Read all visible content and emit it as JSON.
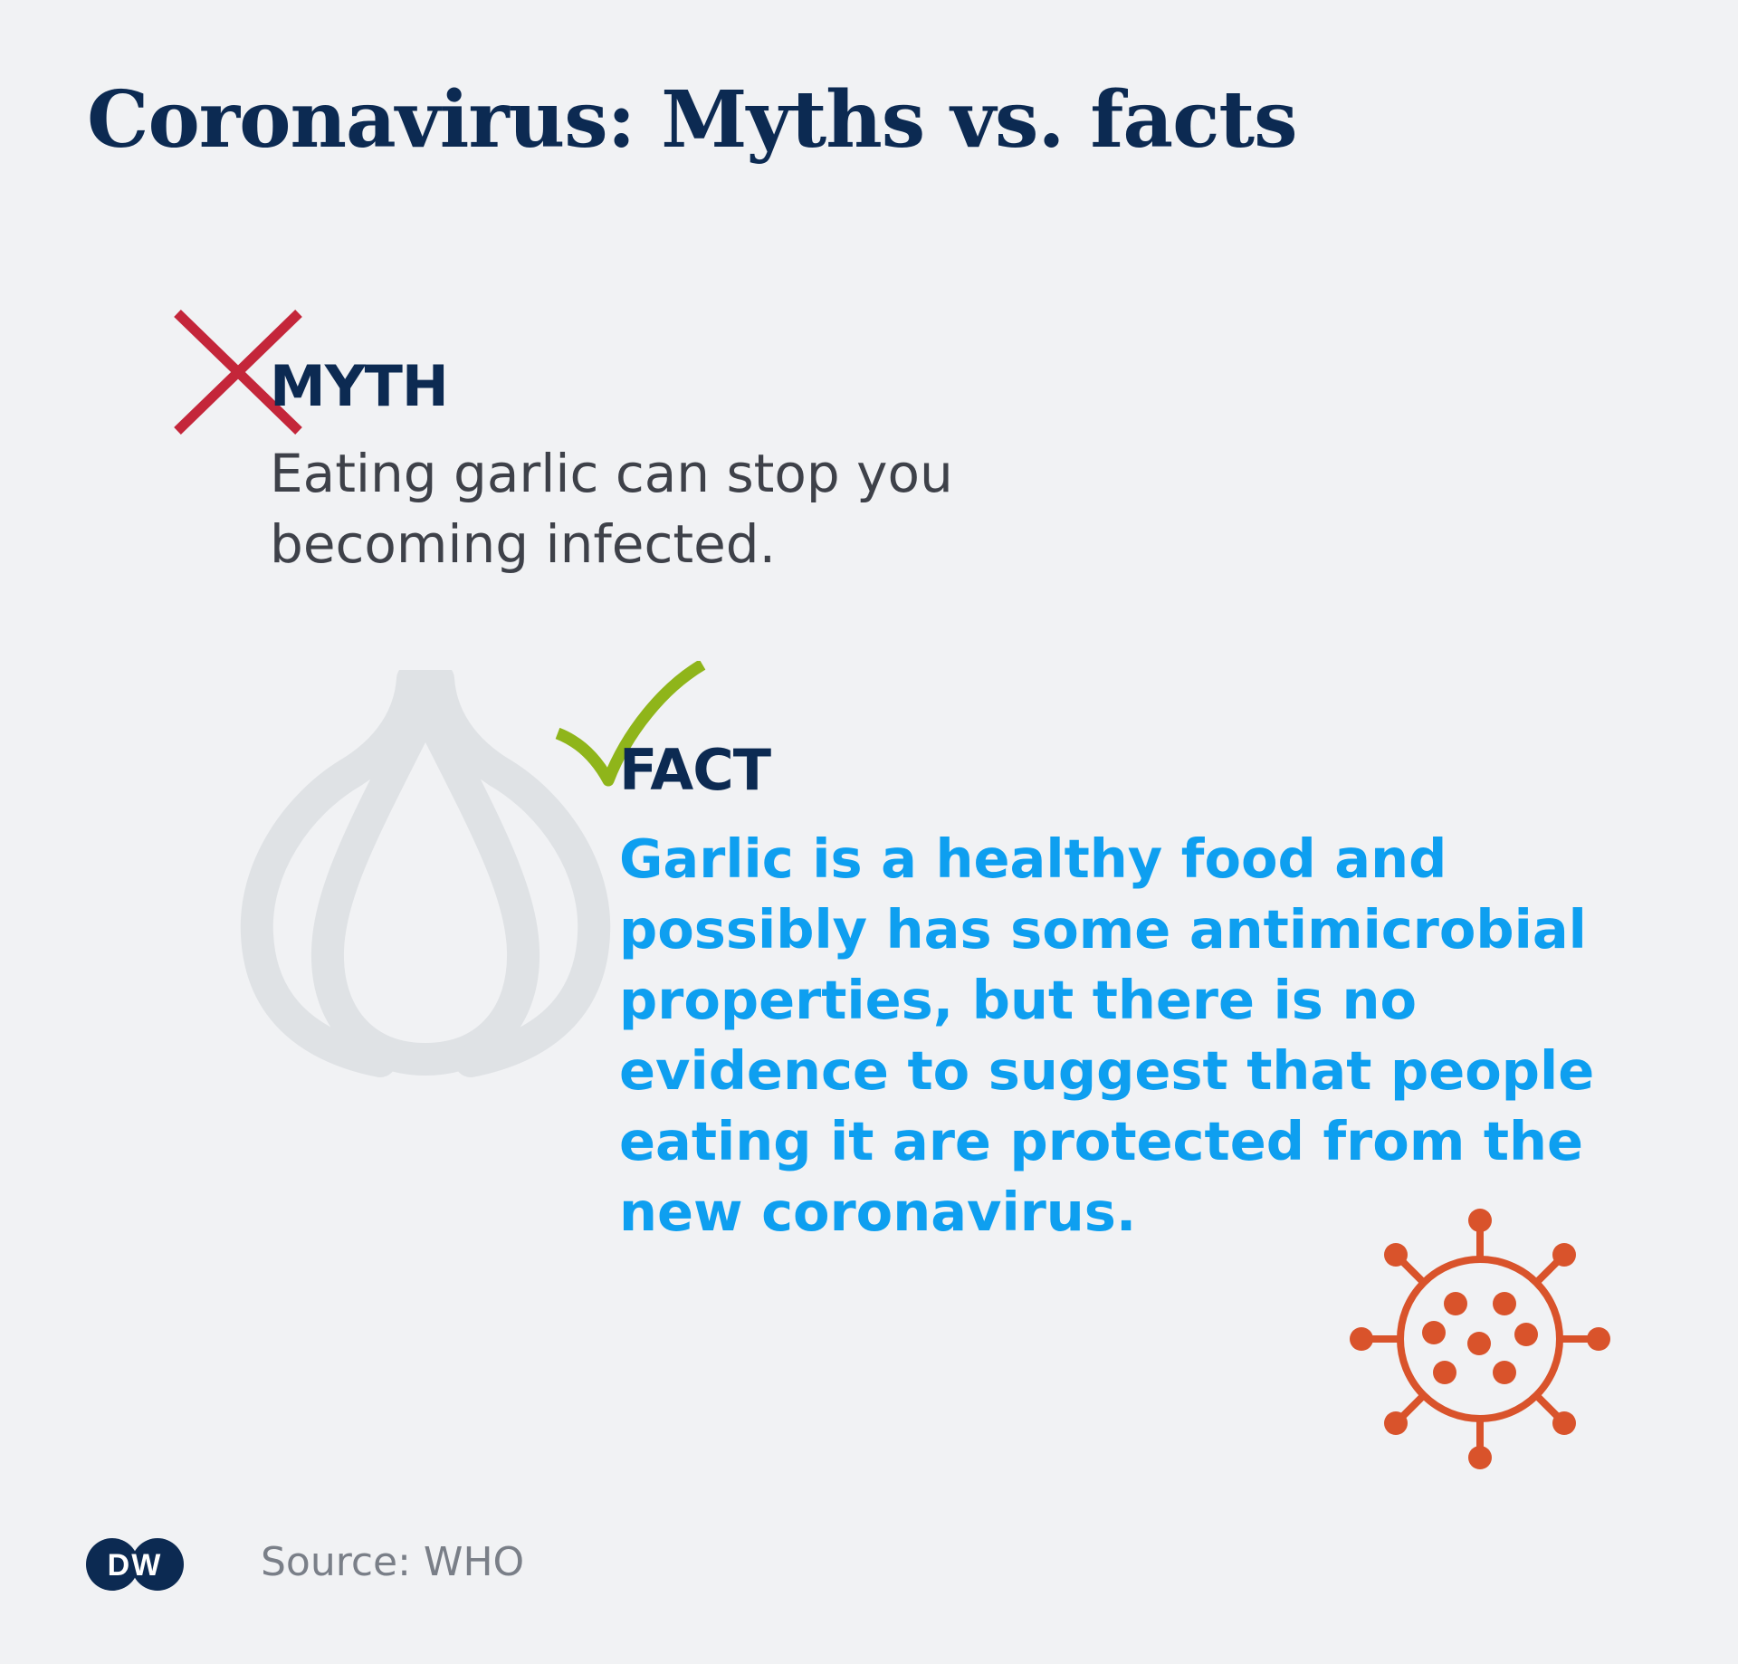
{
  "title": "Coronavirus: Myths vs. facts",
  "myth": {
    "label": "MYTH",
    "text": "Eating garlic can stop you becoming infected.",
    "icon": "cross-mark-icon",
    "color": "#c4263a"
  },
  "fact": {
    "label": "FACT",
    "text": "Garlic is a healthy food and possibly has some antimicrobial properties, but there is no evidence to suggest that people eating it are protected from the new coronavirus.",
    "icon": "check-mark-icon",
    "color": "#8fb51a",
    "text_color": "#0e9ff0"
  },
  "illustrations": {
    "garlic": "garlic-icon",
    "virus": "virus-icon",
    "virus_color": "#d9532b"
  },
  "footer": {
    "logo": "DW",
    "source": "Source: WHO"
  },
  "colors": {
    "background": "#f1f2f4",
    "heading": "#0c2a52"
  }
}
